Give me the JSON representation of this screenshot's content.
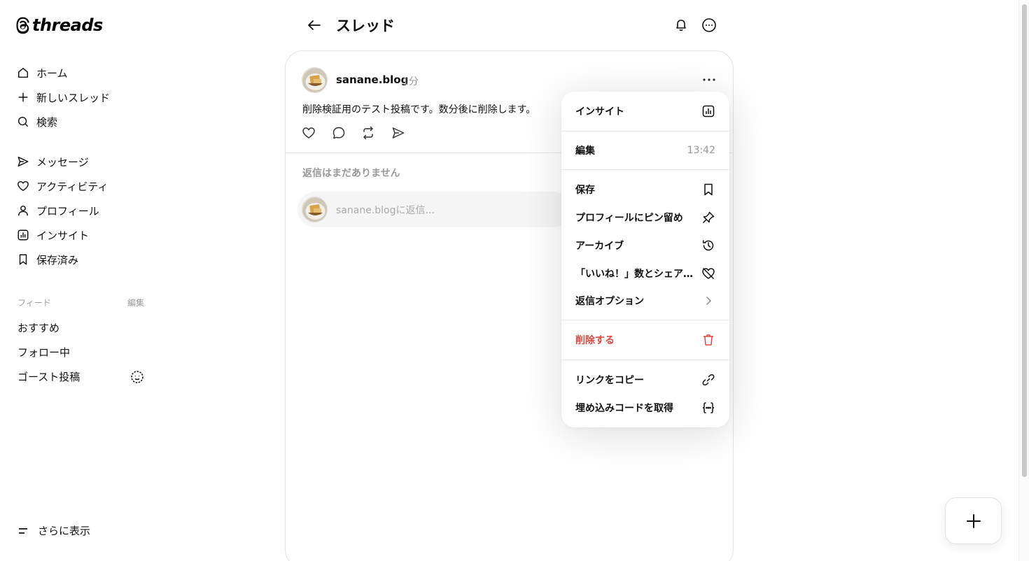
{
  "brand": {
    "name": "threads",
    "logo_icon": "threads-logo-icon"
  },
  "sidebar": {
    "nav": [
      {
        "label": "ホーム",
        "icon": "home-icon"
      },
      {
        "label": "新しいスレッド",
        "icon": "plus-icon"
      },
      {
        "label": "検索",
        "icon": "search-icon"
      },
      {
        "label": "メッセージ",
        "icon": "send-icon"
      },
      {
        "label": "アクティビティ",
        "icon": "heart-icon"
      },
      {
        "label": "プロフィール",
        "icon": "person-icon"
      },
      {
        "label": "インサイト",
        "icon": "insights-icon"
      },
      {
        "label": "保存済み",
        "icon": "bookmark-icon"
      }
    ],
    "feeds_heading": "フィード",
    "feeds_edit": "編集",
    "feeds": [
      {
        "label": "おすすめ"
      },
      {
        "label": "フォロー中"
      },
      {
        "label": "ゴースト投稿",
        "icon": "ghost-icon"
      }
    ],
    "more_label": "さらに表示"
  },
  "header": {
    "title": "スレッド"
  },
  "post": {
    "username": "sanane.blog",
    "time": "1分",
    "text": "削除検証用のテスト投稿です。数分後に削除します。"
  },
  "replies": {
    "empty_text": "返信はまだありません",
    "placeholder": "sanane.blogに返信..."
  },
  "menu": {
    "insights": "インサイト",
    "edit": "編集",
    "edit_time": "13:42",
    "save": "保存",
    "pin": "プロフィールにピン留め",
    "archive": "アーカイブ",
    "hide_likes": "「いいね！」数とシェア数を非表示",
    "reply_options": "返信オプション",
    "delete": "削除する",
    "copy_link": "リンクをコピー",
    "embed": "埋め込みコードを取得"
  },
  "colors": {
    "danger": "#e0483f",
    "muted": "#999999",
    "text": "#111111"
  }
}
